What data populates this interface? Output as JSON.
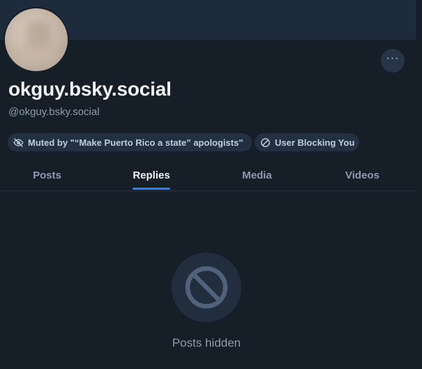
{
  "profile": {
    "display_name": "okguy.bsky.social",
    "handle": "@okguy.bsky.social",
    "more_label": "···"
  },
  "labels": {
    "muted": "Muted by \"“Make Puerto Rico a state” apologists\"",
    "blocking": "User Blocking You"
  },
  "tabs": [
    {
      "label": "Posts",
      "active": false
    },
    {
      "label": "Replies",
      "active": true
    },
    {
      "label": "Media",
      "active": false
    },
    {
      "label": "Videos",
      "active": false
    }
  ],
  "empty_state": {
    "message": "Posts hidden",
    "icon": "ban-icon"
  },
  "colors": {
    "background": "#161e27",
    "banner": "#1e2b3d",
    "accent": "#2f7cf6",
    "muted_text": "#8c9bb0",
    "primary_text": "#f1f3f5"
  }
}
